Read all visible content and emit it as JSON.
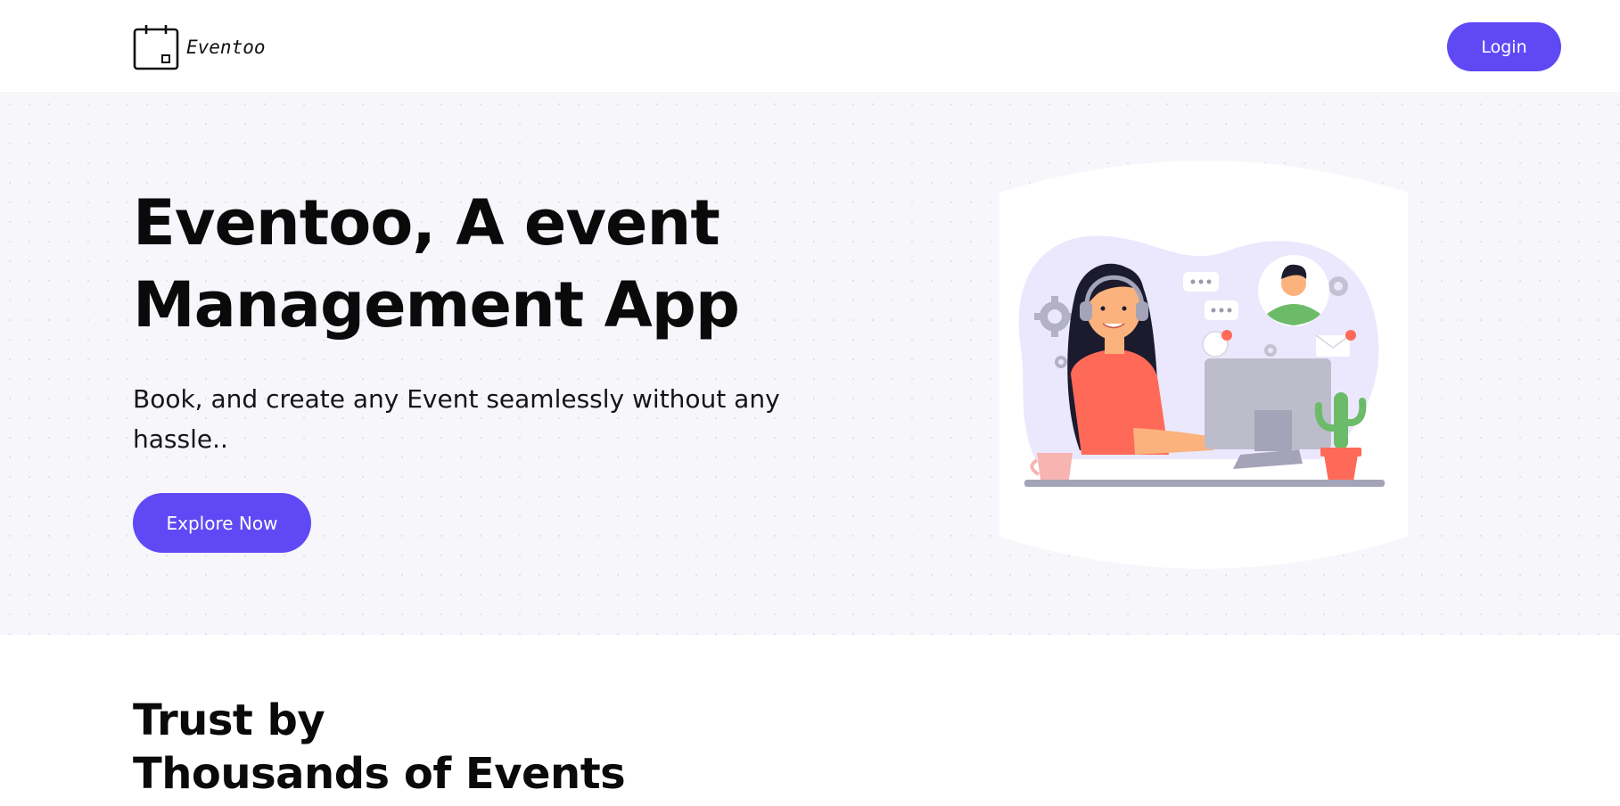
{
  "nav": {
    "brand_name": "Eventoo",
    "logo_icon": "calendar-icon",
    "login_label": "Login"
  },
  "hero": {
    "title_line1": "Eventoo, A event",
    "title_line2": "Management App",
    "subtitle": "Book, and create any Event seamlessly without any hassle..",
    "cta_label": "Explore Now",
    "illustration": "support-agent-illustration"
  },
  "trust": {
    "title_line1": "Trust by",
    "title_line2": "Thousands of Events"
  },
  "colors": {
    "accent": "#6049f5",
    "hero_bg": "#f6f6fb",
    "text": "#0a0a0a",
    "shirt": "#ff6a58",
    "blob": "#ebe8fd"
  }
}
